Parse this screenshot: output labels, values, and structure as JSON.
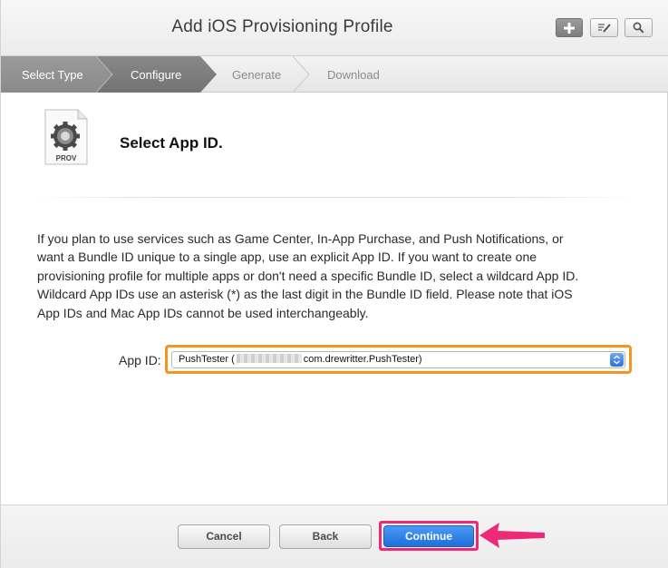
{
  "header": {
    "title": "Add iOS Provisioning Profile",
    "buttons": [
      {
        "name": "add",
        "icon": "plus-icon"
      },
      {
        "name": "edit",
        "icon": "edit-icon"
      },
      {
        "name": "search",
        "icon": "search-icon"
      }
    ]
  },
  "steps": [
    {
      "label": "Select Type",
      "state": "completed"
    },
    {
      "label": "Configure",
      "state": "active"
    },
    {
      "label": "Generate",
      "state": "pending"
    },
    {
      "label": "Download",
      "state": "pending"
    }
  ],
  "content": {
    "icon_label": "PROV",
    "section_title": "Select App ID.",
    "description": "If you plan to use services such as Game Center, In-App Purchase, and Push Notifications, or want a Bundle ID unique to a single app, use an explicit App ID. If you want to create one provisioning profile for multiple apps or don't need a specific Bundle ID, select a wildcard App ID. Wildcard App IDs use an asterisk (*) as the last digit in the Bundle ID field. Please note that iOS App IDs and Mac App IDs cannot be used interchangeably.",
    "app_id_label": "App ID:",
    "app_id_selected_prefix": "PushTester (",
    "app_id_selected_suffix": "com.drewritter.PushTester)"
  },
  "footer": {
    "cancel_label": "Cancel",
    "back_label": "Back",
    "continue_label": "Continue"
  },
  "colors": {
    "step_active": "#7a7a7a",
    "highlight_orange": "#f7931e",
    "highlight_pink": "#ec2a78",
    "continue_blue": "#2f7fe6"
  }
}
